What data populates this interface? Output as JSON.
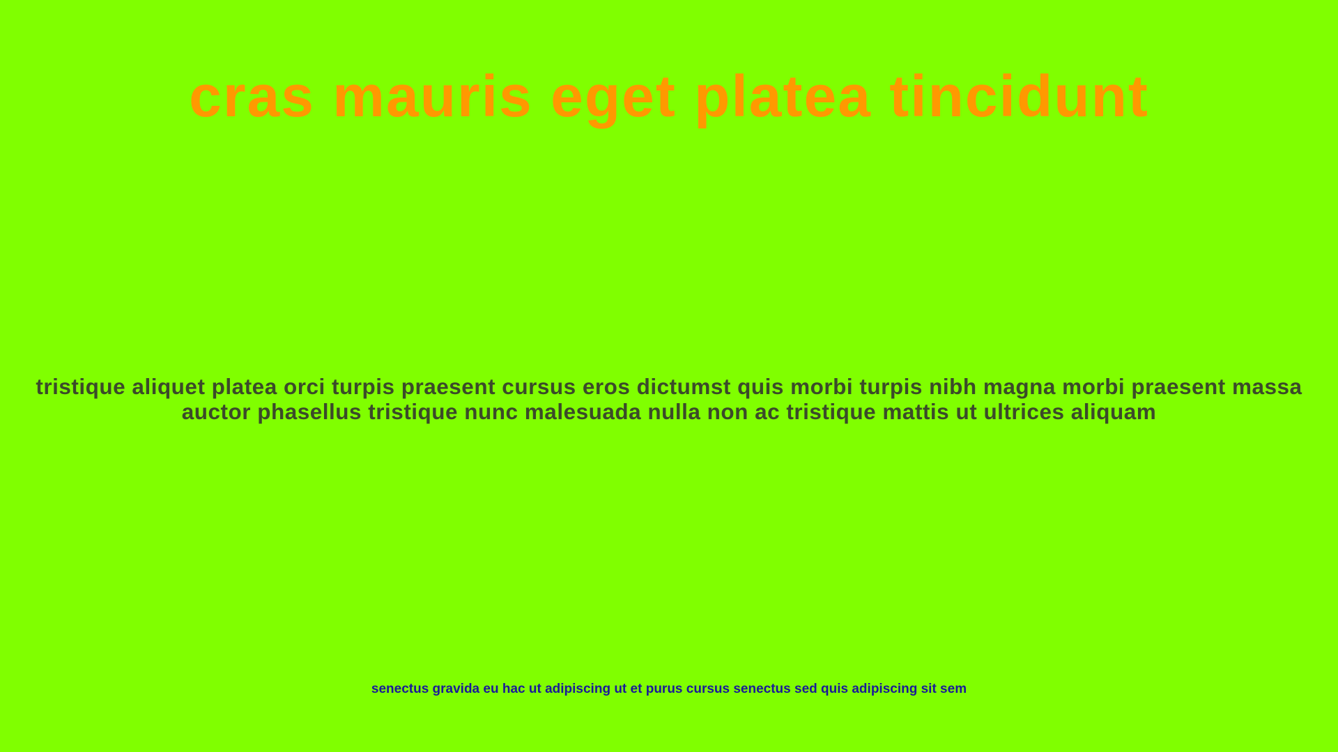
{
  "colors": {
    "background": "#80ff00",
    "title": "#ff9900",
    "body_text": "#3b4a2a",
    "footer_text": "#1a1a99"
  },
  "title": "cras mauris eget platea tincidunt",
  "body_text": "tristique aliquet platea orci turpis praesent cursus eros dictumst quis morbi turpis nibh magna morbi praesent massa auctor phasellus tristique nunc malesuada nulla non ac tristique mattis ut ultrices aliquam",
  "footer": "senectus gravida eu hac ut adipiscing ut et purus cursus senectus sed quis adipiscing sit sem"
}
